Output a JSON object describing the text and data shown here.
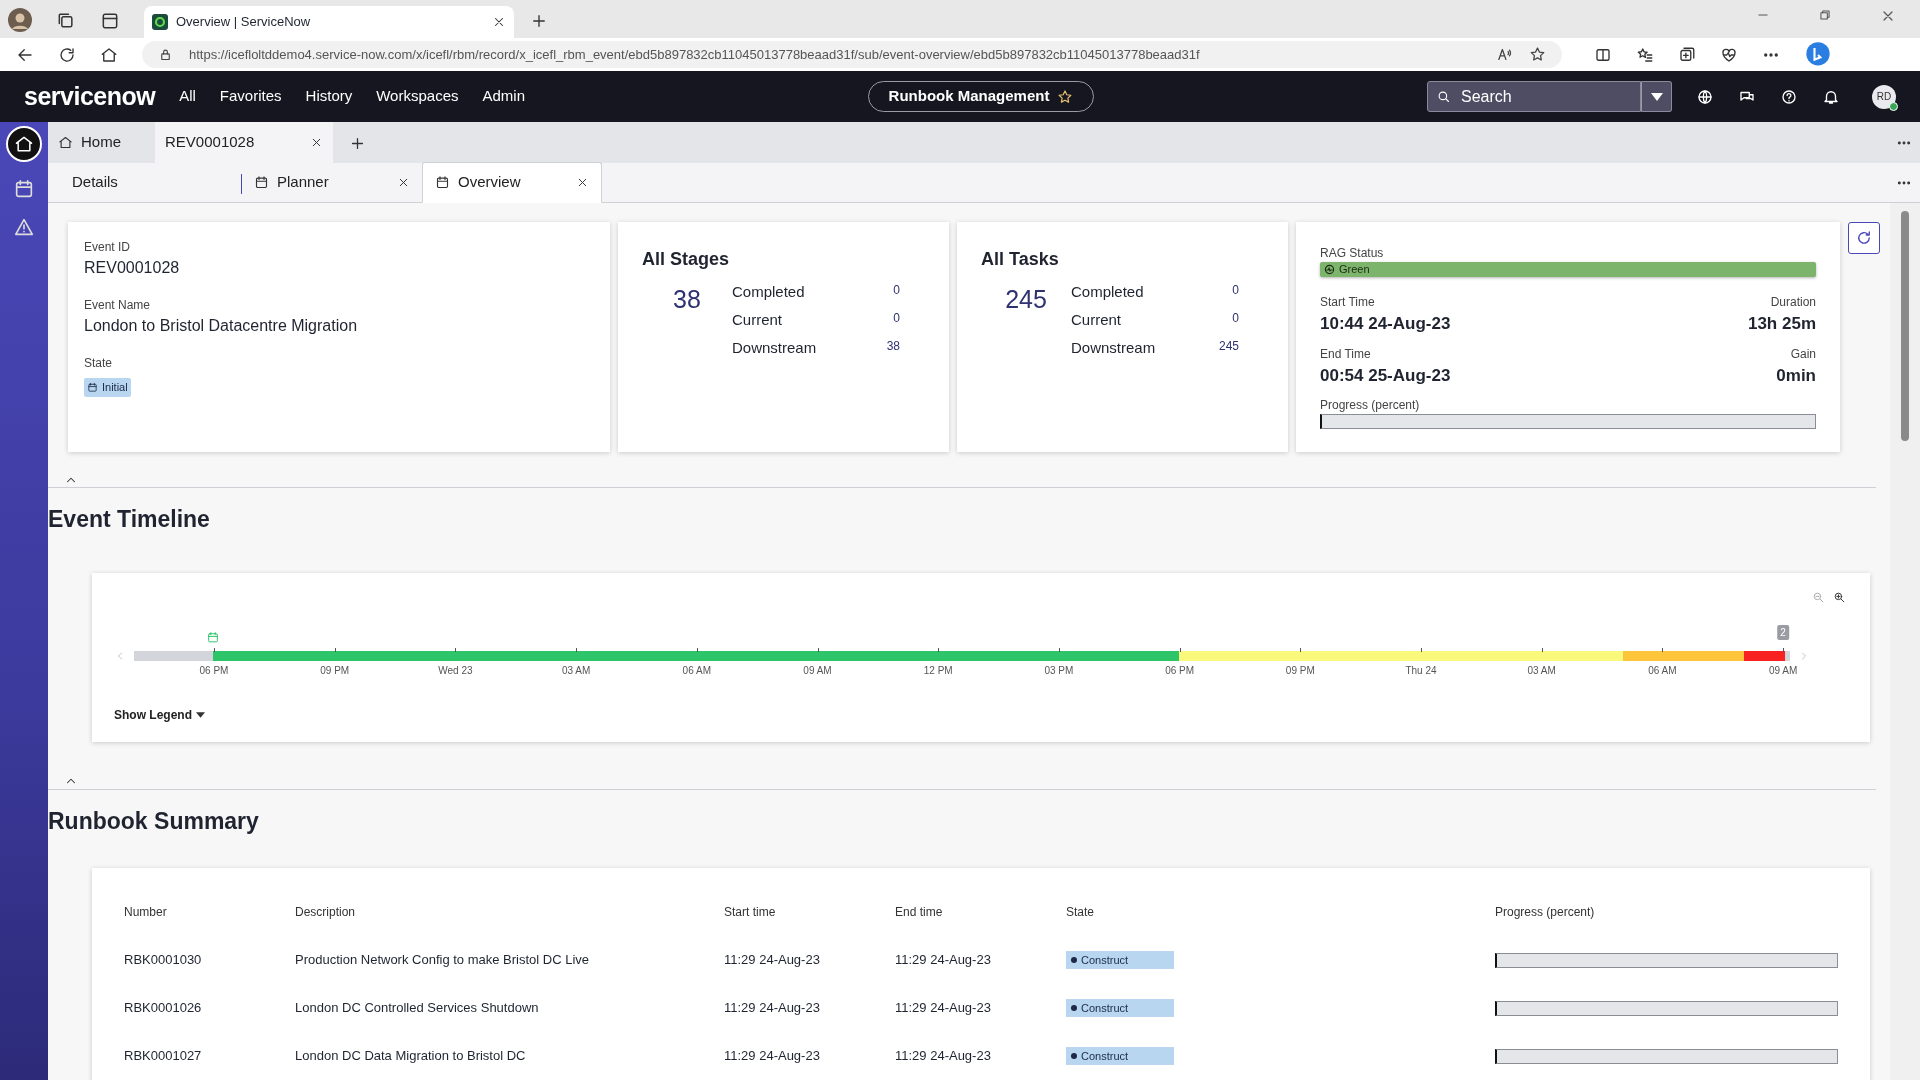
{
  "browser": {
    "tab_title": "Overview | ServiceNow",
    "url": "https://icefloltddemo4.service-now.com/x/icefl/rbm/record/x_icefl_rbm_event/ebd5b897832cb11045013778beaad31f/sub/event-overview/ebd5b897832cb11045013778beaad31f"
  },
  "header": {
    "logo": "servicenow",
    "nav": [
      "All",
      "Favorites",
      "History",
      "Workspaces",
      "Admin"
    ],
    "workspace": "Runbook Management",
    "search": {
      "placeholder": "Search"
    },
    "avatar": "RD"
  },
  "record_tabs": [
    {
      "label": "Home",
      "kind": "home",
      "selected": false
    },
    {
      "label": "REV0001028",
      "kind": "record",
      "selected": true
    }
  ],
  "sub_tabs": [
    {
      "label": "Details",
      "closable": false,
      "selected": false
    },
    {
      "label": "Planner",
      "closable": true,
      "selected": false
    },
    {
      "label": "Overview",
      "closable": true,
      "selected": true
    }
  ],
  "event": {
    "fields": [
      {
        "label": "Event ID",
        "value": "REV0001028"
      },
      {
        "label": "Event Name",
        "value": "London to Bristol Datacentre Migration"
      }
    ],
    "state_label": "State",
    "state": "Initial"
  },
  "counters": [
    {
      "title": "All Stages",
      "total": "38",
      "rows": [
        {
          "label": "Completed",
          "value": "0"
        },
        {
          "label": "Current",
          "value": "0"
        },
        {
          "label": "Downstream",
          "value": "38"
        }
      ]
    },
    {
      "title": "All Tasks",
      "total": "245",
      "rows": [
        {
          "label": "Completed",
          "value": "0"
        },
        {
          "label": "Current",
          "value": "0"
        },
        {
          "label": "Downstream",
          "value": "245"
        }
      ]
    }
  ],
  "status": {
    "rag_label": "RAG Status",
    "rag": "Green",
    "start_label": "Start Time",
    "start": "10:44 24-Aug-23",
    "duration_label": "Duration",
    "duration": "13h 25m",
    "end_label": "End Time",
    "end": "00:54 25-Aug-23",
    "gain_label": "Gain",
    "gain": "0min",
    "progress_label": "Progress (percent)",
    "level": 0
  },
  "timeline": {
    "title": "Event Timeline",
    "ticks": [
      "06 PM",
      "09 PM",
      "Wed 23",
      "03 AM",
      "06 AM",
      "09 AM",
      "12 PM",
      "03 PM",
      "06 PM",
      "09 PM",
      "Thu 24",
      "03 AM",
      "06 AM",
      "09 AM"
    ],
    "marker": "2",
    "legend": "Show Legend"
  },
  "runbooks": {
    "title": "Runbook Summary",
    "columns": [
      "Number",
      "Description",
      "Start time",
      "End time",
      "State",
      "Progress (percent)"
    ],
    "rows": [
      {
        "number": "RBK0001030",
        "description": "Production Network Config to make Bristol DC Live",
        "start": "11:29 24-Aug-23",
        "end": "11:29 24-Aug-23",
        "state": "Construct",
        "level": 0
      },
      {
        "number": "RBK0001026",
        "description": "London DC Controlled Services Shutdown",
        "start": "11:29 24-Aug-23",
        "end": "11:29 24-Aug-23",
        "state": "Construct",
        "level": 0
      },
      {
        "number": "RBK0001027",
        "description": "London DC Data Migration to Bristol DC",
        "start": "11:29 24-Aug-23",
        "end": "11:29 24-Aug-23",
        "state": "Construct",
        "level": 0
      }
    ]
  }
}
